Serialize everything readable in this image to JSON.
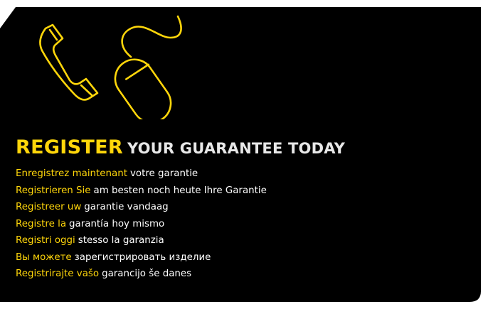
{
  "colors": {
    "background": "#000000",
    "accent": "#ffd60a",
    "text": "#ffffff",
    "heading_secondary": "#e8e8e8"
  },
  "icons": [
    "phone-handset-icon",
    "computer-mouse-icon"
  ],
  "heading": {
    "highlight": "REGISTER",
    "rest": "YOUR GUARANTEE TODAY"
  },
  "translations": [
    {
      "highlight": "Enregistrez maintenant",
      "rest": "votre garantie"
    },
    {
      "highlight": "Registrieren Sie",
      "rest": "am besten noch heute Ihre Garantie"
    },
    {
      "highlight": "Registreer uw",
      "rest": "garantie vandaag"
    },
    {
      "highlight": "Registre la",
      "rest": "garantía hoy mismo"
    },
    {
      "highlight": "Registri oggi",
      "rest": "stesso la garanzia"
    },
    {
      "highlight": "Вы можете",
      "rest": "зарегистрировать изделие"
    },
    {
      "highlight": "Registrirajte vašo",
      "rest": "garancijo še danes"
    }
  ]
}
